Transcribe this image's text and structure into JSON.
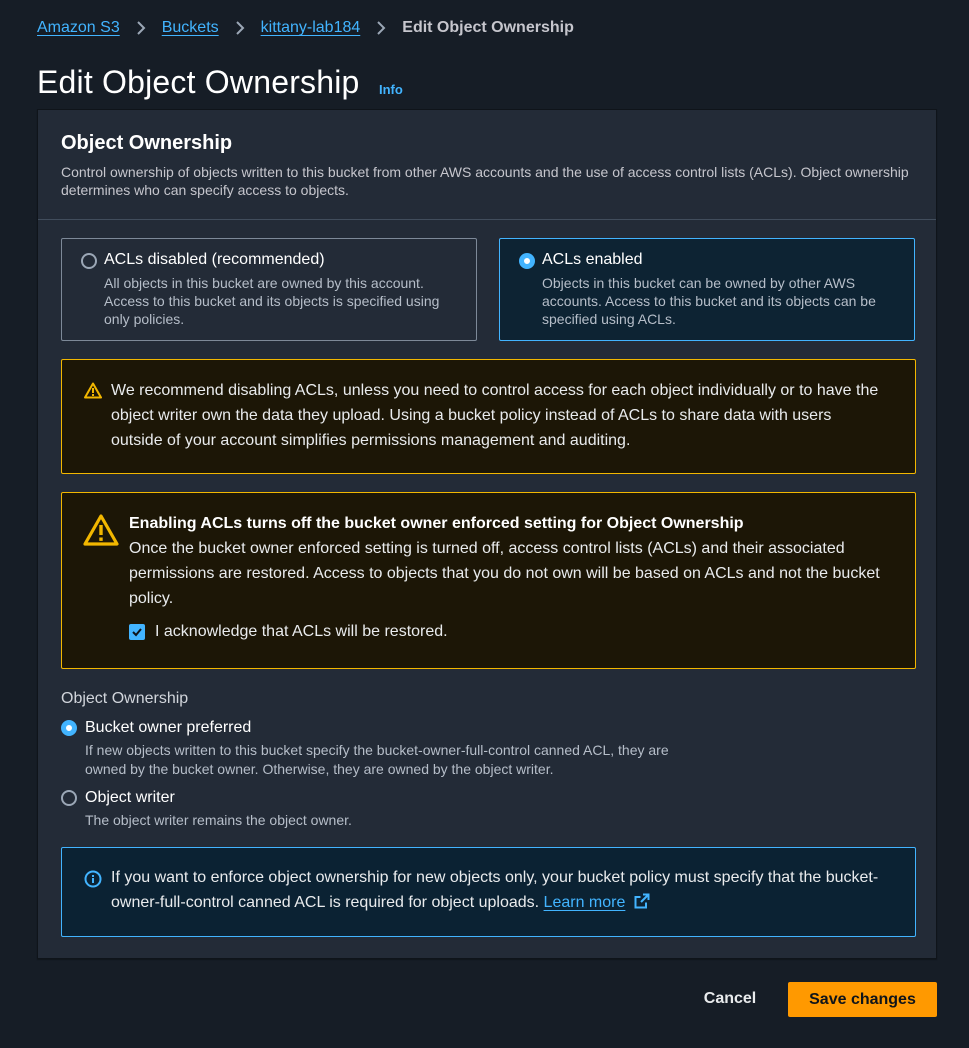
{
  "breadcrumb": {
    "items": [
      "Amazon S3",
      "Buckets",
      "kittany-lab184"
    ],
    "current": "Edit Object Ownership"
  },
  "page": {
    "title": "Edit Object Ownership",
    "info": "Info"
  },
  "panel": {
    "title": "Object Ownership",
    "description": "Control ownership of objects written to this bucket from other AWS accounts and the use of access control lists (ACLs). Object ownership determines who can specify access to objects."
  },
  "tiles": {
    "disabled": {
      "title": "ACLs disabled (recommended)",
      "description": "All objects in this bucket are owned by this account. Access to this bucket and its objects is specified using only policies.",
      "selected": false
    },
    "enabled": {
      "title": "ACLs enabled",
      "description": "Objects in this bucket can be owned by other AWS accounts. Access to this bucket and its objects can be specified using ACLs.",
      "selected": true
    }
  },
  "alerts": {
    "recommend": "We recommend disabling ACLs, unless you need to control access for each object individually or to have the object writer own the data they upload. Using a bucket policy instead of ACLs to share data with users outside of your account simplifies permissions management and auditing.",
    "enabling_heading": "Enabling ACLs turns off the bucket owner enforced setting for Object Ownership",
    "enabling_body": "Once the bucket owner enforced setting is turned off, access control lists (ACLs) and their associated permissions are restored. Access to objects that you do not own will be based on ACLs and not the bucket policy.",
    "acknowledge": "I acknowledge that ACLs will be restored.",
    "acknowledge_checked": true,
    "enforce_text": "If you want to enforce object ownership for new objects only, your bucket policy must specify that the bucket-owner-full-control canned ACL is required for object uploads.",
    "learn_more": "Learn more"
  },
  "ownership": {
    "label": "Object Ownership",
    "options": [
      {
        "title": "Bucket owner preferred",
        "description": "If new objects written to this bucket specify the bucket-owner-full-control canned ACL, they are owned by the bucket owner. Otherwise, they are owned by the object writer.",
        "selected": true
      },
      {
        "title": "Object writer",
        "description": "The object writer remains the object owner.",
        "selected": false
      }
    ]
  },
  "footer": {
    "cancel": "Cancel",
    "save": "Save changes"
  },
  "colors": {
    "accent": "#42b4ff",
    "primary_button": "#ff9900",
    "warning": "#f2b700",
    "background": "#161d26"
  }
}
